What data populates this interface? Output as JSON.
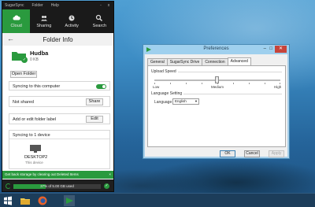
{
  "sugarsync": {
    "menu": [
      "SugarSync",
      "Folder",
      "Help"
    ],
    "window_controls": [
      "-",
      "x"
    ],
    "tabs": [
      {
        "label": "Cloud",
        "icon": "cloud-icon",
        "active": true
      },
      {
        "label": "Sharing",
        "icon": "people-icon",
        "active": false
      },
      {
        "label": "Activity",
        "icon": "activity-icon",
        "active": false
      },
      {
        "label": "Search",
        "icon": "search-icon",
        "active": false
      }
    ],
    "page_title": "Folder Info",
    "folder": {
      "name": "Hudba",
      "size": "0 KB"
    },
    "open_folder_label": "Open Folder",
    "syncing_label": "Syncing to this computer",
    "syncing_on": true,
    "share_row_label": "Not shared",
    "share_button": "Share",
    "edit_row_label": "Add or edit folder label",
    "edit_button": "Edit",
    "devices_header": "Syncing to 1 device",
    "device": {
      "name": "DESKTOP2",
      "sub": "This device"
    },
    "tip": "Get back storage by clearing out Deleted Items",
    "tip_close": "×",
    "storage_text": "37% of 5.00 GB used",
    "storage_fraction": 0.37,
    "accent_color": "#2a9a3e"
  },
  "preferences": {
    "title": "Preferences",
    "tabs": [
      "General",
      "SugarSync Drive",
      "Connection",
      "Advanced"
    ],
    "active_tab": "Advanced",
    "upload_group_label": "Upload Speed",
    "slider_labels": [
      "Low",
      "Medium",
      "High"
    ],
    "slider_value": 0.5,
    "language_group_label": "Language Setting",
    "language_label": "Language",
    "language_value": "English",
    "buttons": {
      "ok": "OK",
      "cancel": "Cancel",
      "apply": "Apply"
    }
  },
  "taskbar": {
    "items": [
      "windows-start-icon",
      "file-explorer-icon",
      "firefox-icon",
      "sugarsync-app-icon"
    ]
  }
}
